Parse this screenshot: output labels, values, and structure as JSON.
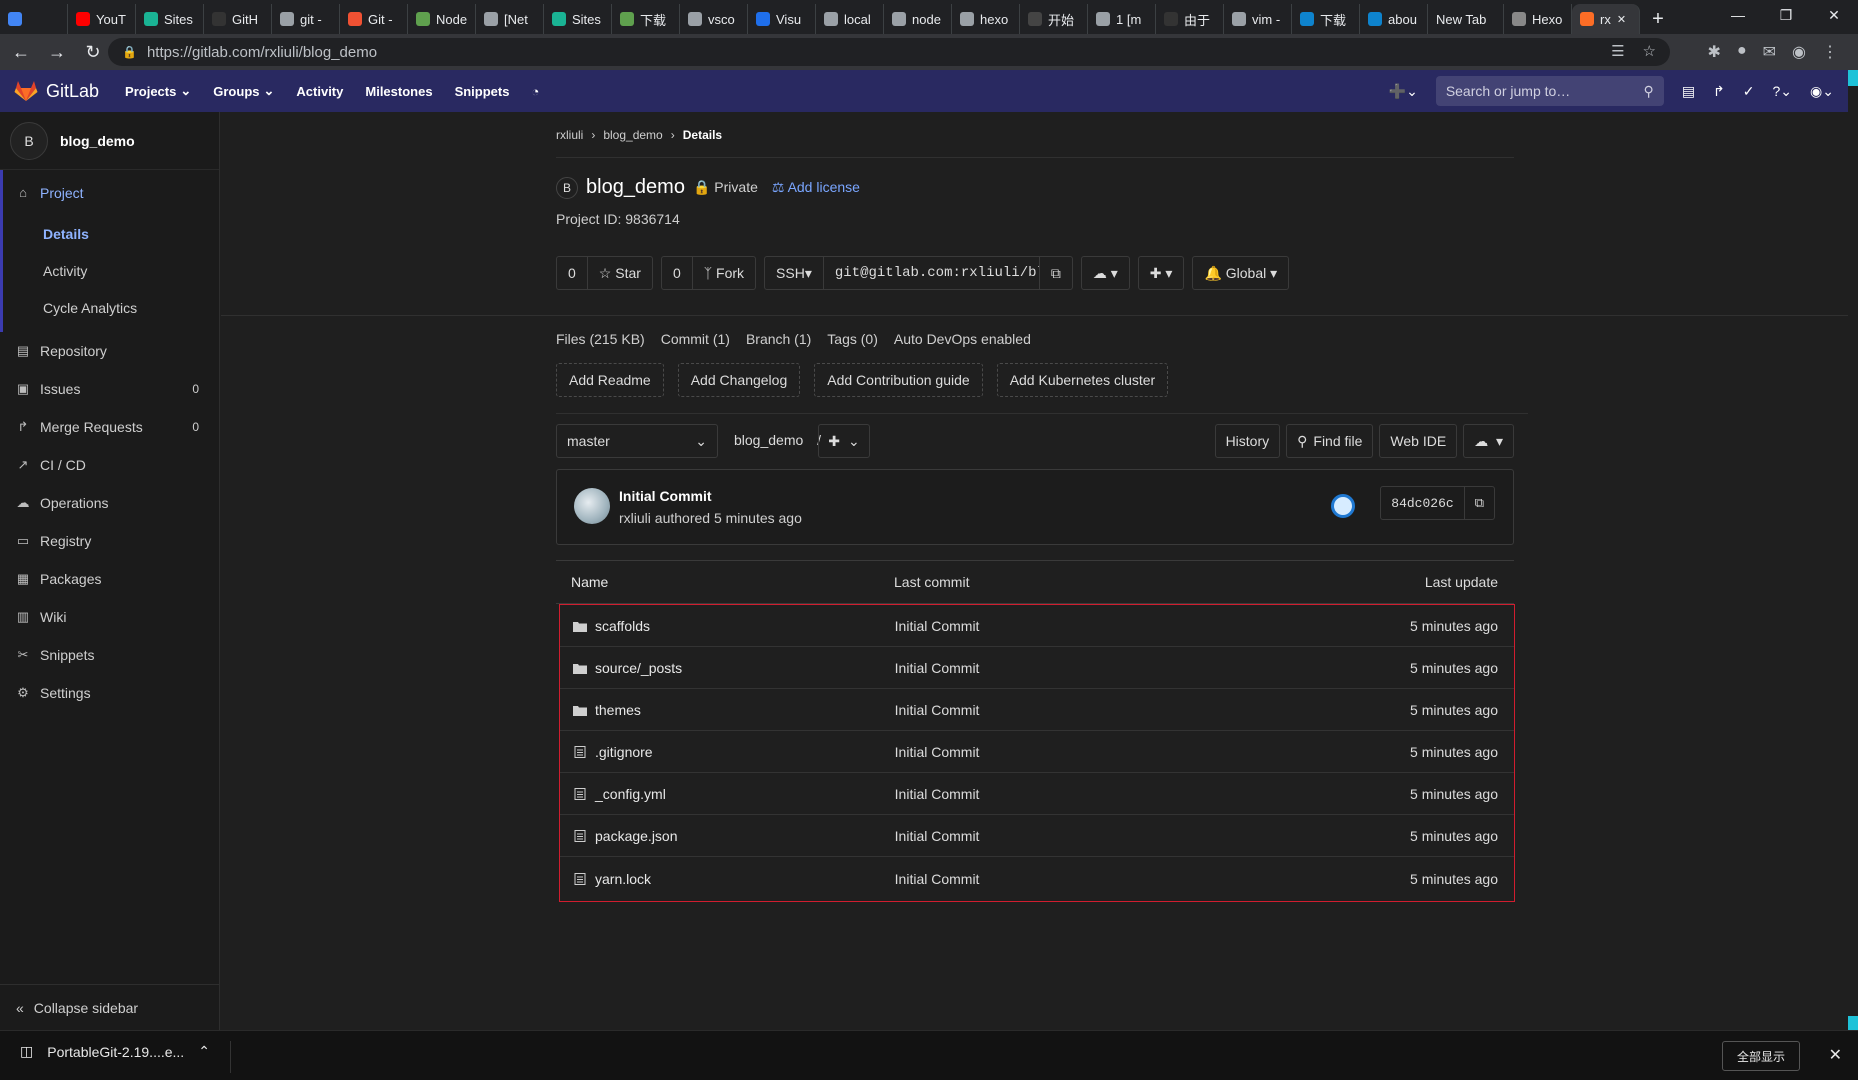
{
  "browser": {
    "tabs": [
      {
        "label": "",
        "color": "#4285f4"
      },
      {
        "label": "YouT",
        "color": "#ff0000"
      },
      {
        "label": "Sites",
        "color": "#1ab394"
      },
      {
        "label": "GitH",
        "color": "#333333"
      },
      {
        "label": "git -",
        "color": "#9aa0a6"
      },
      {
        "label": "Git -",
        "color": "#f05133"
      },
      {
        "label": "Node",
        "color": "#5fa04e"
      },
      {
        "label": "[Net",
        "color": "#9aa0a6"
      },
      {
        "label": "Sites",
        "color": "#1ab394"
      },
      {
        "label": "下载",
        "color": "#5fa04e"
      },
      {
        "label": "vsco",
        "color": "#9aa0a6"
      },
      {
        "label": "Visu",
        "color": "#1f6feb"
      },
      {
        "label": "local",
        "color": "#9aa0a6"
      },
      {
        "label": "node",
        "color": "#9aa0a6"
      },
      {
        "label": "hexo",
        "color": "#9aa0a6"
      },
      {
        "label": "开始",
        "color": "#444444"
      },
      {
        "label": "1 [m",
        "color": "#9aa0a6"
      },
      {
        "label": "由于",
        "color": "#333333"
      },
      {
        "label": "vim -",
        "color": "#9aa0a6"
      },
      {
        "label": "下载",
        "color": "#0e83cd"
      },
      {
        "label": "abou",
        "color": "#0e83cd"
      },
      {
        "label": "New Tab",
        "color": ""
      },
      {
        "label": "Hexo",
        "color": "#888888"
      },
      {
        "label": "rx",
        "color": "#fc6d26"
      }
    ],
    "url": "https://gitlab.com/rxliuli/blog_demo"
  },
  "header": {
    "brand": "GitLab",
    "nav": [
      "Projects",
      "Groups",
      "Activity",
      "Milestones",
      "Snippets"
    ],
    "search_placeholder": "Search or jump to…"
  },
  "sidebar": {
    "project_initial": "B",
    "project_name": "blog_demo",
    "project_label": "Project",
    "sub_items": [
      "Details",
      "Activity",
      "Cycle Analytics"
    ],
    "items": [
      {
        "label": "Repository",
        "icon": "book-icon",
        "count": ""
      },
      {
        "label": "Issues",
        "icon": "issues-icon",
        "count": "0"
      },
      {
        "label": "Merge Requests",
        "icon": "merge-request-icon",
        "count": "0"
      },
      {
        "label": "CI / CD",
        "icon": "rocket-icon",
        "count": ""
      },
      {
        "label": "Operations",
        "icon": "cloud-gear-icon",
        "count": ""
      },
      {
        "label": "Registry",
        "icon": "container-icon",
        "count": ""
      },
      {
        "label": "Packages",
        "icon": "package-icon",
        "count": ""
      },
      {
        "label": "Wiki",
        "icon": "wiki-icon",
        "count": ""
      },
      {
        "label": "Snippets",
        "icon": "scissors-icon",
        "count": ""
      },
      {
        "label": "Settings",
        "icon": "settings-icon",
        "count": ""
      }
    ],
    "collapse_label": "Collapse sidebar"
  },
  "breadcrumb": [
    "rxliuli",
    "blog_demo",
    "Details"
  ],
  "project": {
    "initial": "B",
    "name": "blog_demo",
    "visibility": "Private",
    "add_license": "Add license",
    "id_text": "Project ID: 9836714",
    "star_count": "0",
    "star_label": "Star",
    "fork_count": "0",
    "fork_label": "Fork",
    "clone_protocol": "SSH",
    "clone_url": "git@gitlab.com:rxliuli/blog_demo.git",
    "notification": "Global"
  },
  "stats": [
    "Files (215 KB)",
    "Commit (1)",
    "Branch (1)",
    "Tags (0)",
    "Auto DevOps enabled"
  ],
  "add_buttons": [
    "Add Readme",
    "Add Changelog",
    "Add Contribution guide",
    "Add Kubernetes cluster"
  ],
  "tree": {
    "branch": "master",
    "path": "blog_demo",
    "path_sep": "/",
    "buttons": [
      "History",
      "Find file",
      "Web IDE"
    ]
  },
  "commit": {
    "title": "Initial Commit",
    "meta": "rxliuli authored 5 minutes ago",
    "sha": "84dc026c"
  },
  "table": {
    "headers": [
      "Name",
      "Last commit",
      "Last update"
    ],
    "rows": [
      {
        "name": "scaffolds",
        "type": "folder",
        "commit": "Initial Commit",
        "updated": "5 minutes ago"
      },
      {
        "name": "source/_posts",
        "type": "folder",
        "commit": "Initial Commit",
        "updated": "5 minutes ago"
      },
      {
        "name": "themes",
        "type": "folder",
        "commit": "Initial Commit",
        "updated": "5 minutes ago"
      },
      {
        "name": ".gitignore",
        "type": "file",
        "commit": "Initial Commit",
        "updated": "5 minutes ago"
      },
      {
        "name": "_config.yml",
        "type": "file",
        "commit": "Initial Commit",
        "updated": "5 minutes ago"
      },
      {
        "name": "package.json",
        "type": "file",
        "commit": "Initial Commit",
        "updated": "5 minutes ago"
      },
      {
        "name": "yarn.lock",
        "type": "file",
        "commit": "Initial Commit",
        "updated": "5 minutes ago"
      }
    ]
  },
  "downloads": {
    "file": "PortableGit-2.19....e...",
    "show_all": "全部显示"
  }
}
